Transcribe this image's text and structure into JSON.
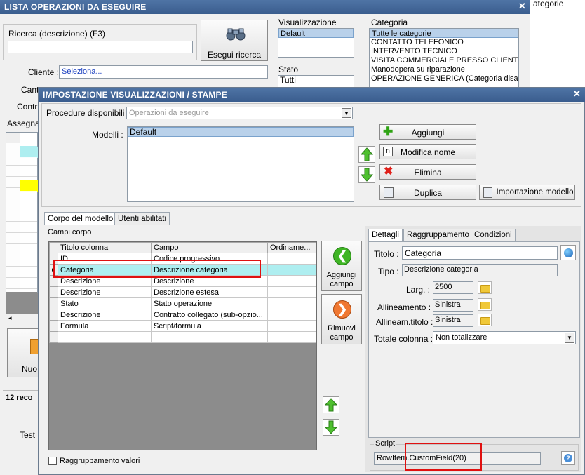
{
  "back_window": {
    "title": "LISTA OPERAZIONI DA ESEGUIRE",
    "right_edge_text": "ategorie",
    "search_label": "Ricerca (descrizione) (F3)",
    "search_value": "",
    "search_button": "Esegui ricerca",
    "cliente_label": "Cliente :",
    "cliente_value": "Seleziona...",
    "cant_label": "Cant",
    "contr_label": "Contr",
    "assegna_label": "Assegna",
    "visualizzazione_label": "Visualizzazione",
    "visualizzazione_items": [
      "Default"
    ],
    "stato_label": "Stato",
    "stato_items": [
      "Tutti"
    ],
    "categoria_label": "Categoria",
    "categoria_items": [
      "Tutte le categorie",
      "CONTATTO TELEFONICO",
      "INTERVENTO TECNICO",
      "VISITA COMMERCIALE PRESSO CLIENTE",
      "Manodopera su riparazione",
      "OPERAZIONE GENERICA (Categoria disatti"
    ],
    "nuovo_label": "Nuo",
    "records_label": "12 reco",
    "test_label": "Test"
  },
  "dialog": {
    "title": "IMPOSTAZIONE VISUALIZZAZIONI / STAMPE",
    "procedure_label": "Procedure disponibili :",
    "procedure_value": "Operazioni da eseguire",
    "modelli_label": "Modelli :",
    "modelli_items": [
      "Default"
    ],
    "aggiungi_label": "Aggiungi",
    "modifica_label": "Modifica nome",
    "elimina_label": "Elimina",
    "duplica_label": "Duplica",
    "importazione_label": "Importazione modello",
    "tabs": [
      "Corpo del modello",
      "Utenti abilitati"
    ],
    "campi_corpo_label": "Campi corpo",
    "grid": {
      "columns": [
        "Titolo colonna",
        "Campo",
        "Ordiname..."
      ],
      "rows": [
        [
          "ID",
          "Codice progressivo",
          ""
        ],
        [
          "Categoria",
          "Descrizione categoria",
          ""
        ],
        [
          "Descrizione",
          "Descrizione",
          ""
        ],
        [
          "Descrizione",
          "Descrizione estesa",
          ""
        ],
        [
          "Stato",
          "Stato operazione",
          ""
        ],
        [
          "Descrizione",
          "Contratto collegato (sub-opzio...",
          ""
        ],
        [
          "Formula",
          "Script/formula",
          ""
        ],
        [
          "",
          "",
          ""
        ]
      ]
    },
    "aggiungi_campo_label": "Aggiungi campo",
    "rimuovi_campo_label": "Rimuovi campo",
    "raggruppamento_valori_label": "Raggruppamento valori",
    "detail_tabs": [
      "Dettagli",
      "Raggruppamento",
      "Condizioni"
    ],
    "titolo_label": "Titolo :",
    "titolo_value": "Categoria",
    "tipo_label": "Tipo :",
    "tipo_value": "Descrizione categoria",
    "larg_label": "Larg. :",
    "larg_value": "2500",
    "allineamento_label": "Allineamento :",
    "allineamento_value": "Sinistra",
    "allineam_titolo_label": "Allineam.titolo :",
    "allineam_titolo_value": "Sinistra",
    "totale_label": "Totale colonna :",
    "totale_value": "Non totalizzare",
    "script_label": "Script",
    "script_value": "RowItem.CustomField(20)"
  },
  "colors": {
    "title_bar": "#3f6396",
    "selection": "#b9d1ea",
    "highlight_row": "#aeeef0",
    "annotation": "#e01010"
  }
}
